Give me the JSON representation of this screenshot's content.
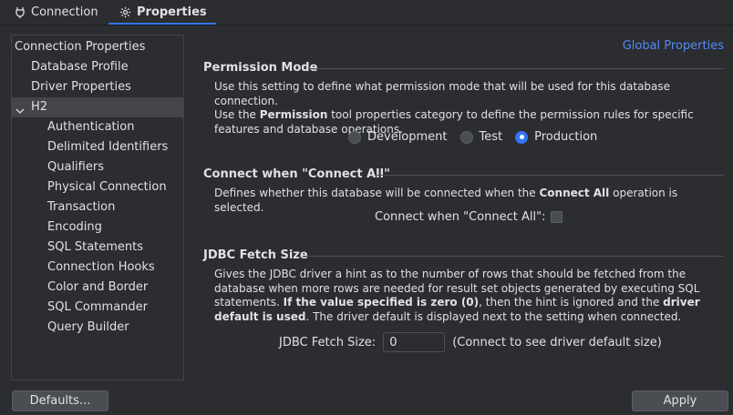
{
  "tabs": [
    {
      "label": "Connection",
      "icon": "plug-icon",
      "active": false
    },
    {
      "label": "Properties",
      "icon": "gear-icon",
      "active": true
    }
  ],
  "tree": {
    "items": [
      {
        "label": "Connection Properties",
        "level": 0
      },
      {
        "label": "Database Profile",
        "level": 1
      },
      {
        "label": "Driver Properties",
        "level": 1
      },
      {
        "label": "H2",
        "level": 0,
        "expanded": true,
        "selected": true
      },
      {
        "label": "Authentication",
        "level": 2
      },
      {
        "label": "Delimited Identifiers",
        "level": 2
      },
      {
        "label": "Qualifiers",
        "level": 2
      },
      {
        "label": "Physical Connection",
        "level": 2
      },
      {
        "label": "Transaction",
        "level": 2
      },
      {
        "label": "Encoding",
        "level": 2
      },
      {
        "label": "SQL Statements",
        "level": 2
      },
      {
        "label": "Connection Hooks",
        "level": 2
      },
      {
        "label": "Color and Border",
        "level": 2
      },
      {
        "label": "SQL Commander",
        "level": 2
      },
      {
        "label": "Query Builder",
        "level": 2
      }
    ]
  },
  "global_link": "Global Properties",
  "permission": {
    "title": "Permission Mode",
    "desc1": "Use this setting to define what permission mode that will be used for this database connection.",
    "desc2_pre": "Use the ",
    "desc2_bold": "Permission",
    "desc2_post": " tool properties category to define the permission rules for specific features and database operations.",
    "options": [
      "Development",
      "Test",
      "Production"
    ],
    "selected": "Production"
  },
  "connect_all": {
    "title": "Connect when \"Connect All\"",
    "desc_pre": "Defines whether this database will be connected when the ",
    "desc_bold": "Connect All",
    "desc_post": " operation is selected.",
    "checkbox_label": "Connect when \"Connect All\":",
    "checked": false
  },
  "fetch": {
    "title": "JDBC Fetch Size",
    "desc_a": "Gives the JDBC driver a hint as to the number of rows that should be fetched from the database when more rows are needed for result set objects generated by executing SQL statements. ",
    "desc_b": "If the value specified is zero (0)",
    "desc_c": ", then the hint is ignored and the ",
    "desc_d": "driver default is used",
    "desc_e": ". The driver default is displayed next to the setting when connected.",
    "label": "JDBC Fetch Size:",
    "value": "0",
    "note": "(Connect to see driver default size)"
  },
  "buttons": {
    "defaults": "Defaults...",
    "apply": "Apply"
  }
}
